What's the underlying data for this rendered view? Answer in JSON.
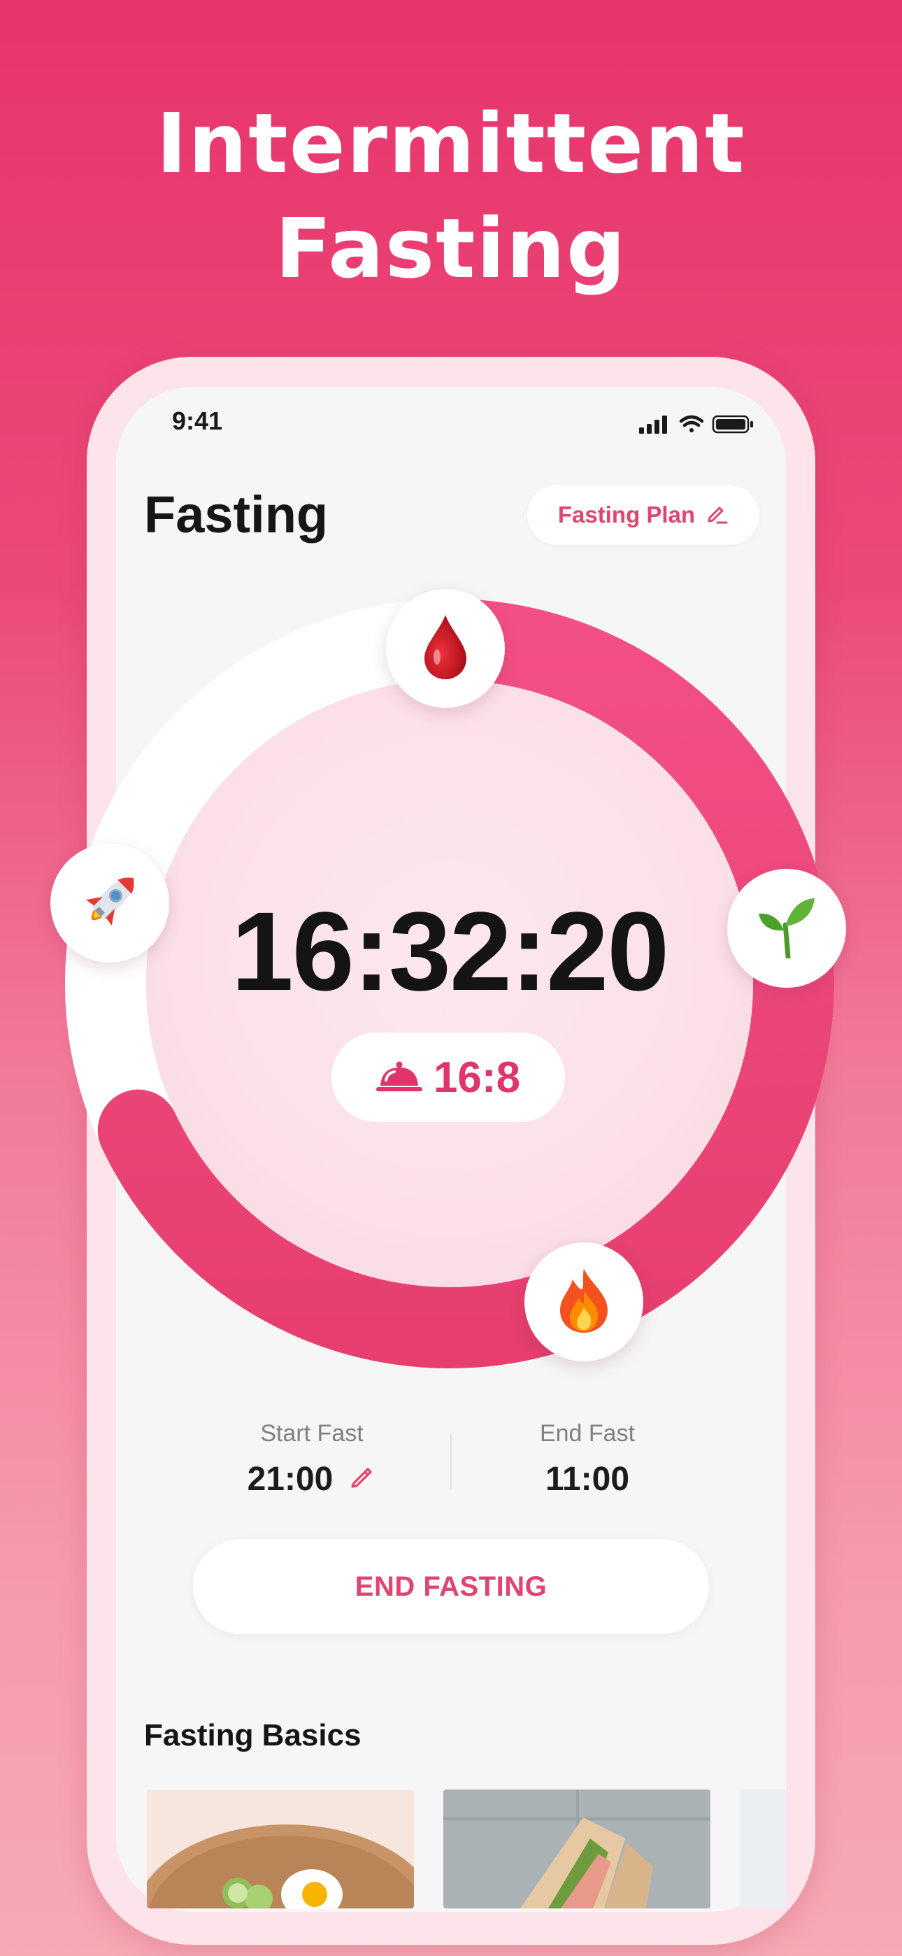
{
  "headline": {
    "line1": "Intermittent",
    "line2": "Fasting"
  },
  "status_bar": {
    "time": "9:41"
  },
  "screen": {
    "title": "Fasting",
    "plan_button_label": "Fasting Plan"
  },
  "timer": {
    "elapsed": "16:32:20",
    "plan_ratio": "16:8",
    "progress_fraction": 0.68
  },
  "stages": [
    {
      "name": "blood-sugar",
      "icon": "blood-drop-icon"
    },
    {
      "name": "fat-burning",
      "icon": "sprout-icon"
    },
    {
      "name": "ketosis",
      "icon": "fire-icon"
    },
    {
      "name": "autophagy",
      "icon": "rocket-icon"
    }
  ],
  "schedule": {
    "start_label": "Start Fast",
    "start_value": "21:00",
    "end_label": "End Fast",
    "end_value": "11:00"
  },
  "actions": {
    "end_button_label": "END FASTING"
  },
  "basics": {
    "title": "Fasting Basics"
  },
  "colors": {
    "accent": "#e0456f",
    "ring": "#f04f82",
    "background_top": "#e8356c",
    "background_bottom": "#f7a9b4"
  }
}
